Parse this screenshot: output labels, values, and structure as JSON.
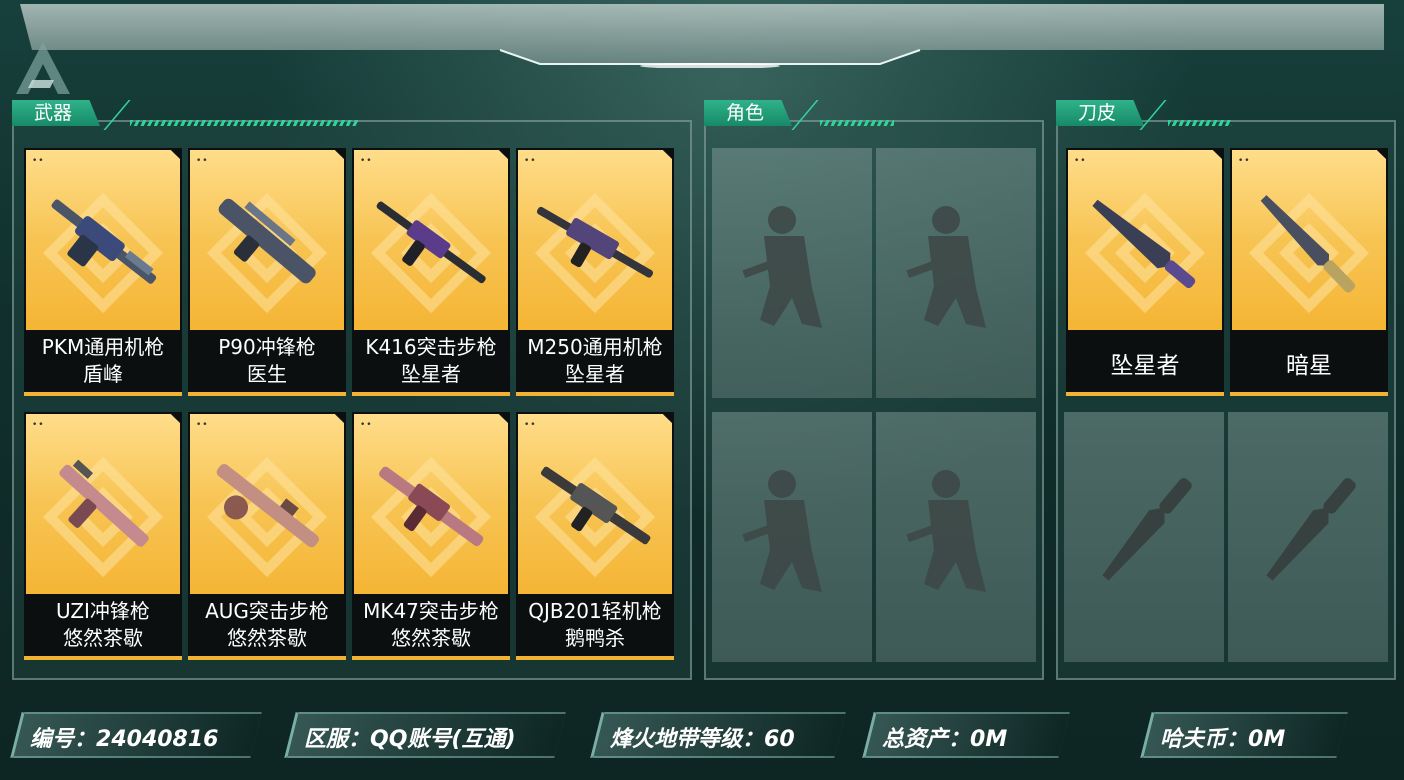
{
  "sections": {
    "weapons": "武器",
    "characters": "角色",
    "knife_skins": "刀皮"
  },
  "weapons": [
    {
      "line1": "PKM通用机枪",
      "line2": "盾峰"
    },
    {
      "line1": "P90冲锋枪",
      "line2": "医生"
    },
    {
      "line1": "K416突击步枪",
      "line2": "坠星者"
    },
    {
      "line1": "M250通用机枪",
      "line2": "坠星者"
    },
    {
      "line1": "UZI冲锋枪",
      "line2": "悠然茶歇"
    },
    {
      "line1": "AUG突击步枪",
      "line2": "悠然茶歇"
    },
    {
      "line1": "MK47突击步枪",
      "line2": "悠然茶歇"
    },
    {
      "line1": "QJB201轻机枪",
      "line2": "鹅鸭杀"
    }
  ],
  "knives": [
    {
      "name": "坠星者"
    },
    {
      "name": "暗星"
    }
  ],
  "footer": {
    "id_label": "编号：",
    "id_value": "24040816",
    "server_label": "区服：",
    "server_value": "QQ账号(互通)",
    "level_label": "烽火地带等级：",
    "level_value": "60",
    "assets_label": "总资产：",
    "assets_value": "0M",
    "coin_label": "哈夫币：",
    "coin_value": "0M"
  },
  "colors": {
    "accent": "#2fb28a",
    "card_gold": "#f7c453",
    "background": "#11302d"
  }
}
